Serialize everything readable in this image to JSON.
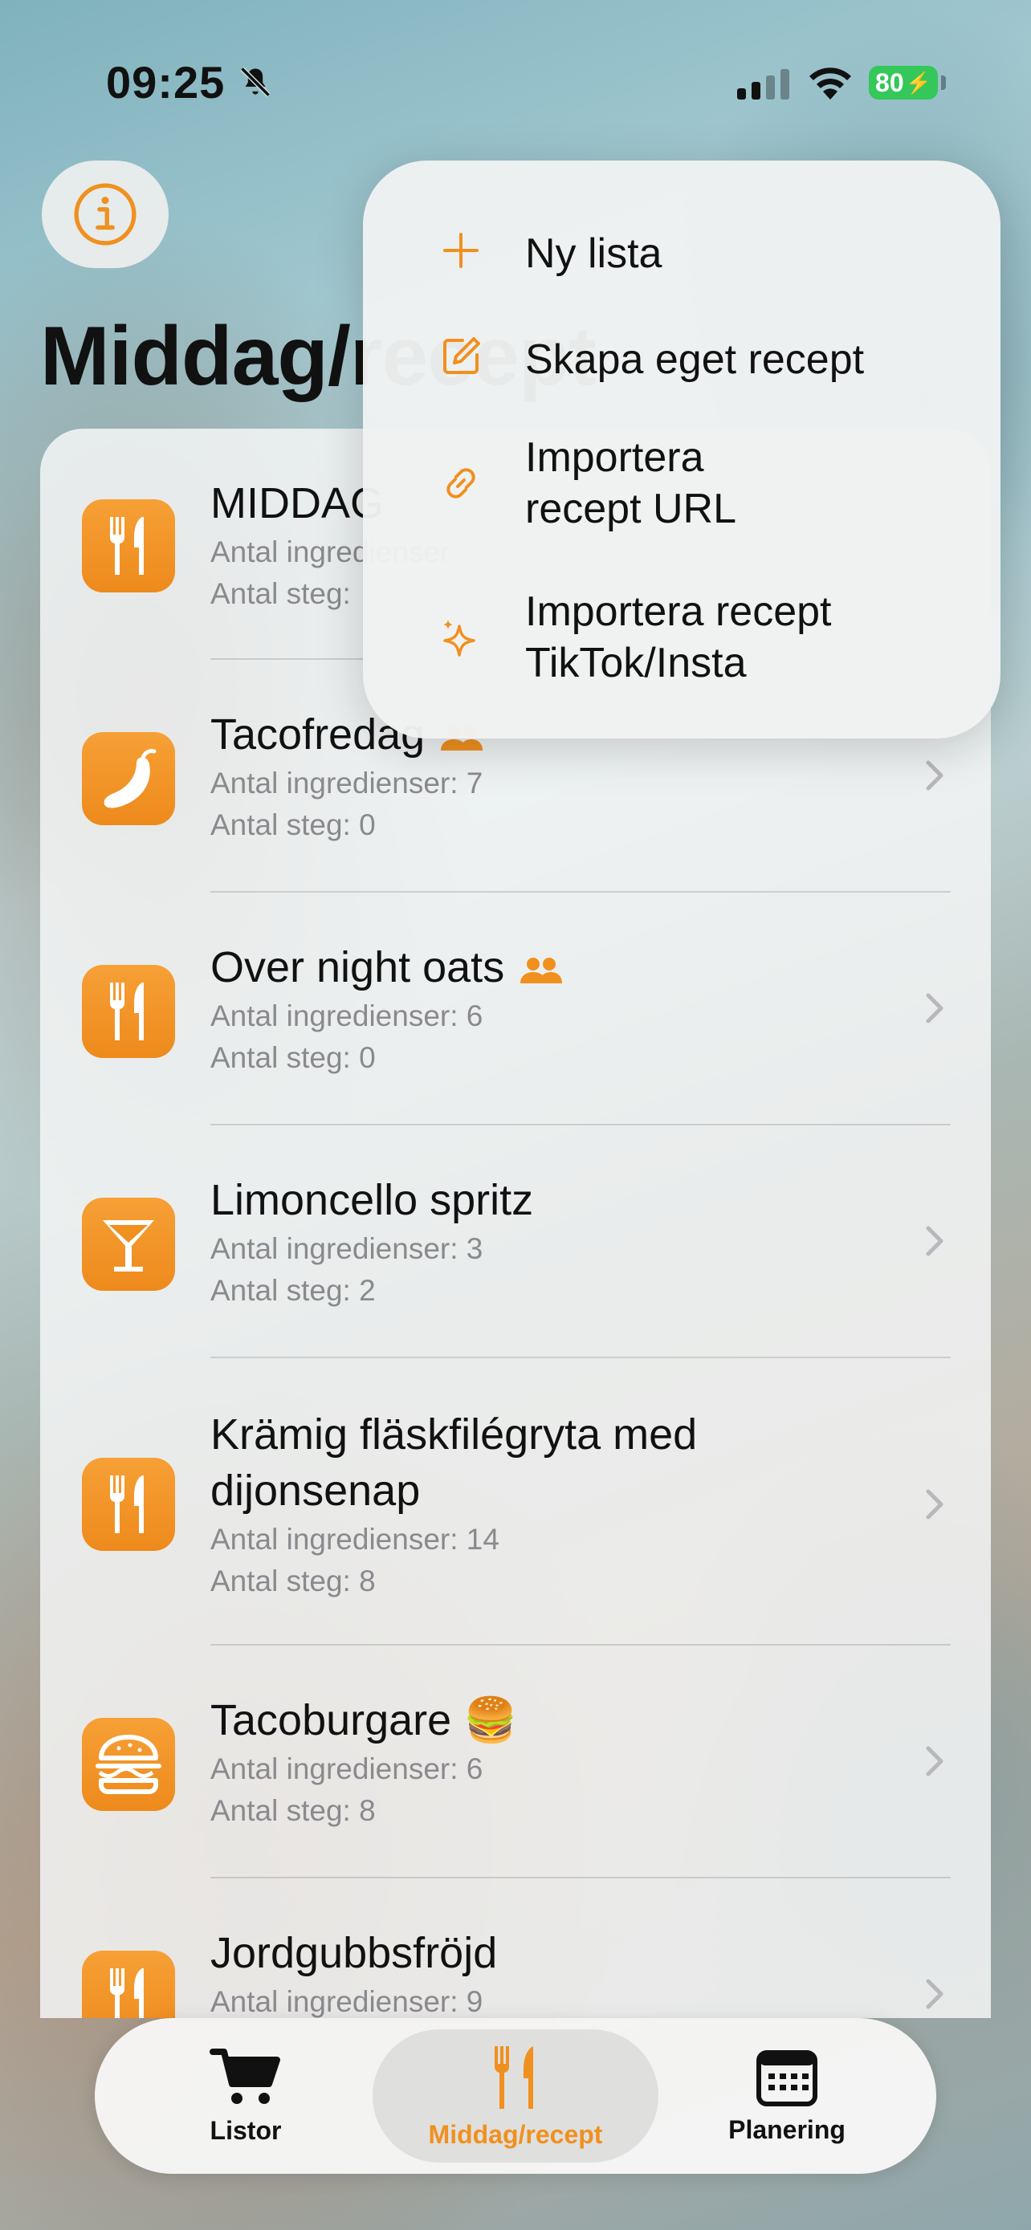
{
  "status_bar": {
    "time": "09:25",
    "battery": "80"
  },
  "header": {
    "title": "Middag/recept"
  },
  "recipes": [
    {
      "title": "MIDDAG",
      "ingredients": "Antal ingredienser",
      "steps": "Antal steg:",
      "icon": "fork-knife-icon"
    },
    {
      "title": "Tacofredag",
      "ingredients": "Antal ingredienser: 7",
      "steps": "Antal steg: 0",
      "icon": "chili-pepper-icon",
      "shared": true
    },
    {
      "title": "Over night oats",
      "ingredients": "Antal ingredienser: 6",
      "steps": "Antal steg: 0",
      "icon": "fork-knife-icon",
      "shared": true
    },
    {
      "title": "Limoncello spritz",
      "ingredients": "Antal ingredienser: 3",
      "steps": "Antal steg: 2",
      "icon": "cocktail-glass-icon"
    },
    {
      "title": "Krämig fläskfilégryta med dijonsenap",
      "ingredients": "Antal ingredienser: 14",
      "steps": "Antal steg: 8",
      "icon": "fork-knife-icon"
    },
    {
      "title": "Tacoburgare 🍔",
      "ingredients": "Antal ingredienser: 6",
      "steps": "Antal steg: 8",
      "icon": "burger-icon"
    },
    {
      "title": "Jordgubbsfröjd",
      "ingredients": "Antal ingredienser: 9",
      "steps": "",
      "icon": "fork-knife-icon"
    }
  ],
  "menu": {
    "items": [
      {
        "label": "Ny lista",
        "icon": "plus-icon"
      },
      {
        "label": "Skapa eget recept",
        "icon": "compose-icon"
      },
      {
        "label": "Importera\nrecept URL",
        "icon": "link-icon"
      },
      {
        "label": "Importera recept\nTikTok/Insta",
        "icon": "sparkles-icon"
      }
    ]
  },
  "tab_bar": {
    "tabs": [
      {
        "label": "Listor",
        "icon": "cart-icon"
      },
      {
        "label": "Middag/recept",
        "icon": "fork-knife-icon",
        "active": true
      },
      {
        "label": "Planering",
        "icon": "calendar-icon"
      }
    ]
  },
  "colors": {
    "accent": "#F0901F",
    "battery": "#34C759"
  }
}
